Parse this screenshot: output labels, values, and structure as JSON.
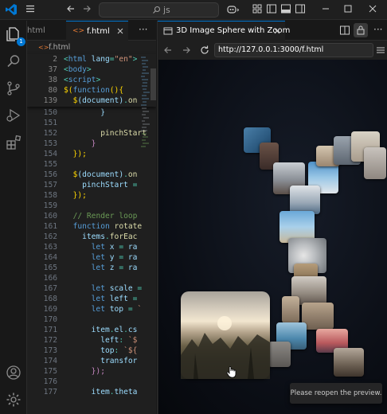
{
  "titlebar": {
    "search_text": "js"
  },
  "activity": {
    "explorer_badge": "1"
  },
  "editor": {
    "tabs": [
      {
        "label": "html"
      },
      {
        "label": "f.html"
      }
    ],
    "breadcrumb": "f.html",
    "sticky_lines": [
      {
        "num": "2",
        "tokens": [
          [
            "t",
            "<"
          ],
          [
            "k",
            "html"
          ],
          [
            "v",
            " lang"
          ],
          [
            "t",
            "="
          ],
          [
            "s",
            "\"en\""
          ],
          [
            "t",
            ">"
          ]
        ]
      },
      {
        "num": "37",
        "tokens": [
          [
            "t",
            "<"
          ],
          [
            "k",
            "body"
          ],
          [
            "t",
            ">"
          ]
        ]
      },
      {
        "num": "38",
        "tokens": [
          [
            "t",
            "<"
          ],
          [
            "k",
            "script"
          ],
          [
            "t",
            ">"
          ]
        ]
      },
      {
        "num": "80",
        "tokens": [
          [
            "y",
            "$"
          ],
          [
            "y",
            "("
          ],
          [
            "k",
            "function"
          ],
          [
            "y",
            "(){"
          ]
        ]
      },
      {
        "num": "139",
        "tokens": [
          [
            "t",
            "  "
          ],
          [
            "y",
            "$"
          ],
          [
            "v",
            "("
          ],
          [
            "v",
            "document"
          ],
          [
            "v",
            ")"
          ],
          [
            "t",
            "."
          ],
          [
            "f",
            "on"
          ]
        ]
      }
    ],
    "lines": [
      {
        "num": "150",
        "tokens": [
          [
            "t",
            "        "
          ],
          [
            "v",
            "}"
          ]
        ]
      },
      {
        "num": "151",
        "tokens": [
          [
            "t",
            ""
          ]
        ]
      },
      {
        "num": "152",
        "tokens": [
          [
            "t",
            "        "
          ],
          [
            "f",
            "pinchStart"
          ]
        ]
      },
      {
        "num": "153",
        "tokens": [
          [
            "t",
            "      "
          ],
          [
            "p",
            "}"
          ]
        ]
      },
      {
        "num": "154",
        "tokens": [
          [
            "t",
            "  "
          ],
          [
            "y",
            "});"
          ]
        ]
      },
      {
        "num": "155",
        "tokens": [
          [
            "t",
            ""
          ]
        ]
      },
      {
        "num": "156",
        "tokens": [
          [
            "t",
            "  "
          ],
          [
            "y",
            "$"
          ],
          [
            "v",
            "("
          ],
          [
            "v",
            "document"
          ],
          [
            "v",
            ")"
          ],
          [
            "t",
            "."
          ],
          [
            "f",
            "on"
          ]
        ]
      },
      {
        "num": "157",
        "tokens": [
          [
            "t",
            "    "
          ],
          [
            "v",
            "pinchStart"
          ],
          [
            "t",
            " ="
          ]
        ]
      },
      {
        "num": "158",
        "tokens": [
          [
            "t",
            "  "
          ],
          [
            "y",
            "});"
          ]
        ]
      },
      {
        "num": "159",
        "tokens": [
          [
            "t",
            ""
          ]
        ]
      },
      {
        "num": "160",
        "tokens": [
          [
            "t",
            "  "
          ],
          [
            "c",
            "// Render loop"
          ]
        ]
      },
      {
        "num": "161",
        "tokens": [
          [
            "t",
            "  "
          ],
          [
            "k",
            "function"
          ],
          [
            "f",
            " rotate"
          ]
        ]
      },
      {
        "num": "162",
        "tokens": [
          [
            "t",
            "    "
          ],
          [
            "v",
            "items"
          ],
          [
            "t",
            "."
          ],
          [
            "f",
            "forEac"
          ]
        ]
      },
      {
        "num": "163",
        "tokens": [
          [
            "t",
            "      "
          ],
          [
            "k",
            "let"
          ],
          [
            "v",
            " x"
          ],
          [
            "t",
            " = "
          ],
          [
            "v",
            "ra"
          ]
        ]
      },
      {
        "num": "164",
        "tokens": [
          [
            "t",
            "      "
          ],
          [
            "k",
            "let"
          ],
          [
            "v",
            " y"
          ],
          [
            "t",
            " = "
          ],
          [
            "v",
            "ra"
          ]
        ]
      },
      {
        "num": "165",
        "tokens": [
          [
            "t",
            "      "
          ],
          [
            "k",
            "let"
          ],
          [
            "v",
            " z"
          ],
          [
            "t",
            " = "
          ],
          [
            "v",
            "ra"
          ]
        ]
      },
      {
        "num": "166",
        "tokens": [
          [
            "t",
            ""
          ]
        ]
      },
      {
        "num": "167",
        "tokens": [
          [
            "t",
            "      "
          ],
          [
            "k",
            "let"
          ],
          [
            "v",
            " scale"
          ],
          [
            "t",
            " ="
          ]
        ]
      },
      {
        "num": "168",
        "tokens": [
          [
            "t",
            "      "
          ],
          [
            "k",
            "let"
          ],
          [
            "v",
            " left"
          ],
          [
            "t",
            " ="
          ]
        ]
      },
      {
        "num": "169",
        "tokens": [
          [
            "t",
            "      "
          ],
          [
            "k",
            "let"
          ],
          [
            "v",
            " top"
          ],
          [
            "t",
            " = "
          ],
          [
            "s",
            "`"
          ]
        ]
      },
      {
        "num": "170",
        "tokens": [
          [
            "t",
            ""
          ]
        ]
      },
      {
        "num": "171",
        "tokens": [
          [
            "t",
            "      "
          ],
          [
            "v",
            "item"
          ],
          [
            "t",
            "."
          ],
          [
            "v",
            "el"
          ],
          [
            "t",
            "."
          ],
          [
            "v",
            "cs"
          ]
        ]
      },
      {
        "num": "172",
        "tokens": [
          [
            "t",
            "        "
          ],
          [
            "v",
            "left"
          ],
          [
            "t",
            ": "
          ],
          [
            "s",
            "`$"
          ]
        ]
      },
      {
        "num": "173",
        "tokens": [
          [
            "t",
            "        "
          ],
          [
            "v",
            "top"
          ],
          [
            "t",
            ": "
          ],
          [
            "s",
            "`${"
          ]
        ]
      },
      {
        "num": "174",
        "tokens": [
          [
            "t",
            "        "
          ],
          [
            "v",
            "transfor"
          ]
        ]
      },
      {
        "num": "175",
        "tokens": [
          [
            "t",
            "      "
          ],
          [
            "p",
            "});"
          ]
        ]
      },
      {
        "num": "176",
        "tokens": [
          [
            "t",
            ""
          ]
        ]
      },
      {
        "num": "177",
        "tokens": [
          [
            "t",
            "      "
          ],
          [
            "v",
            "item"
          ],
          [
            "t",
            "."
          ],
          [
            "v",
            "theta"
          ]
        ]
      }
    ]
  },
  "browser": {
    "tab_title": "3D Image Sphere with Zoom",
    "url": "http://127.0.0.1:3000/f.html",
    "toast": "Please reopen the preview."
  },
  "colors": {
    "accent": "#0078d4",
    "editor_bg": "#1f1f1f",
    "chrome_bg": "#181818"
  }
}
